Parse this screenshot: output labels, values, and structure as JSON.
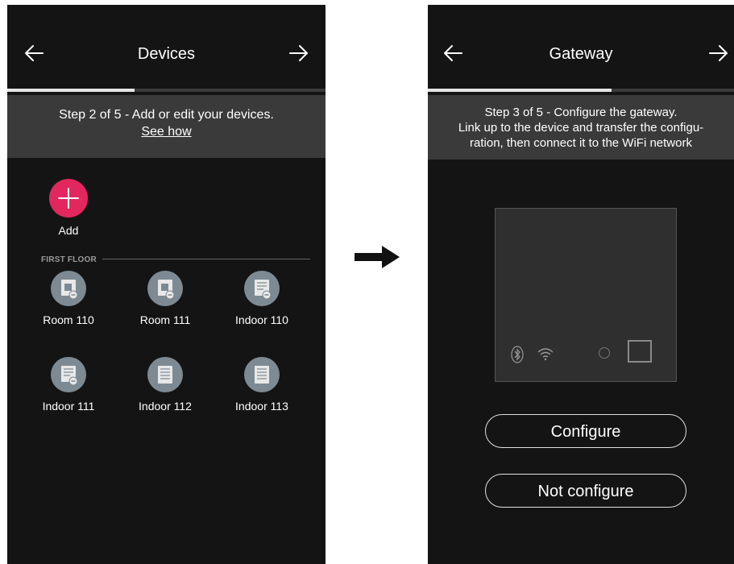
{
  "screen1": {
    "title": "Devices",
    "step_text": "Step 2 of 5 - Add or edit your devices.",
    "see_how": "See how",
    "progress": 0.4,
    "add_label": "Add",
    "section": "FIRST FLOOR",
    "devices": [
      {
        "label": "Room 110",
        "icon": "room-device-icon"
      },
      {
        "label": "Room 111",
        "icon": "room-device-icon"
      },
      {
        "label": "Indoor 110",
        "icon": "indoor-linked-device-icon"
      },
      {
        "label": "Indoor 111",
        "icon": "indoor-linked-device-icon"
      },
      {
        "label": "Indoor 112",
        "icon": "indoor-device-icon"
      },
      {
        "label": "Indoor 113",
        "icon": "indoor-device-icon"
      }
    ]
  },
  "transition_icon": "right-arrow-icon",
  "screen2": {
    "title": "Gateway",
    "step_lines": [
      "Step 3 of 5 - Configure the gateway.",
      "Link up to the device and transfer the configu-",
      "ration, then connect it to the WiFi network"
    ],
    "progress": 0.6,
    "configure_label": "Configure",
    "not_configure_label": "Not configure"
  },
  "colors": {
    "background": "#141414",
    "step_bar": "#3a3a3a",
    "add_accent": "#e2275f",
    "device_circle": "#7d8a93"
  }
}
